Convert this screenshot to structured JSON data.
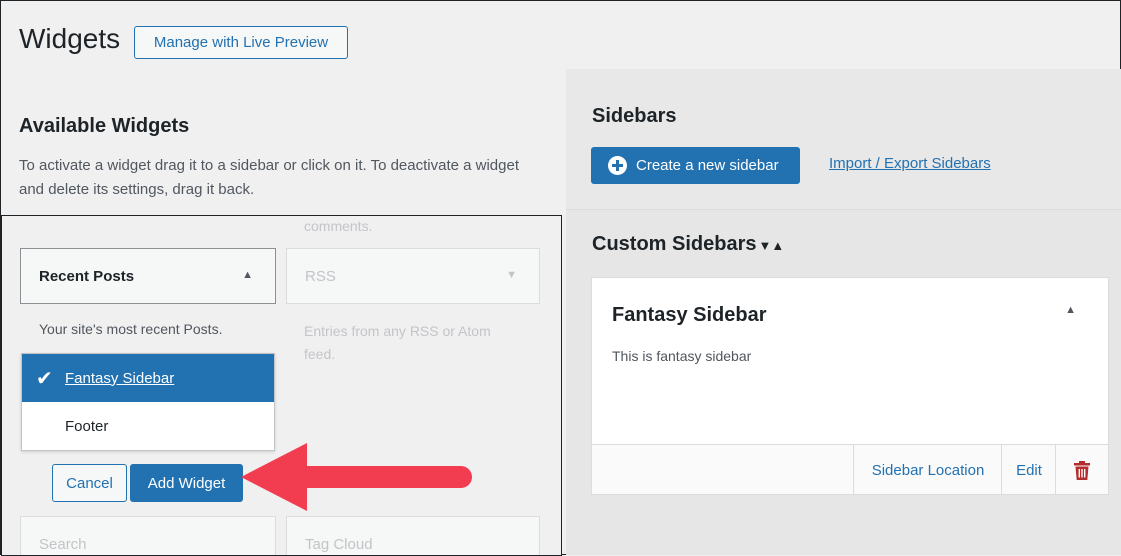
{
  "header": {
    "title": "Widgets",
    "live_preview_label": "Manage with Live Preview"
  },
  "available": {
    "title": "Available Widgets",
    "description": "To activate a widget drag it to a sidebar or click on it. To deactivate a widget and delete its settings, drag it back.",
    "faded_top_text": "comments.",
    "recent_posts": {
      "label": "Recent Posts",
      "description": "Your site's most recent Posts."
    },
    "rss": {
      "label": "RSS",
      "description": "Entries from any RSS or Atom feed."
    },
    "dropdown": {
      "options": [
        "Fantasy Sidebar",
        "Footer"
      ],
      "selected": "Fantasy Sidebar"
    },
    "cancel_label": "Cancel",
    "add_label": "Add Widget",
    "search_label": "Search",
    "tag_cloud_label": "Tag Cloud"
  },
  "sidebars": {
    "title": "Sidebars",
    "create_label": "Create a new sidebar",
    "import_label": "Import / Export Sidebars",
    "custom_title": "Custom Sidebars",
    "sort_glyph": "▼▲",
    "card": {
      "title": "Fantasy Sidebar",
      "description": "This is fantasy sidebar",
      "location_label": "Sidebar Location",
      "edit_label": "Edit"
    }
  },
  "colors": {
    "accent": "#2271b1",
    "delete": "#b32d2e",
    "annotation_arrow": "#f23c4f"
  },
  "icons": {
    "check": "check-icon",
    "plus": "plus-circle-icon",
    "trash": "trash-icon",
    "toggle": "triangle-up-icon"
  }
}
